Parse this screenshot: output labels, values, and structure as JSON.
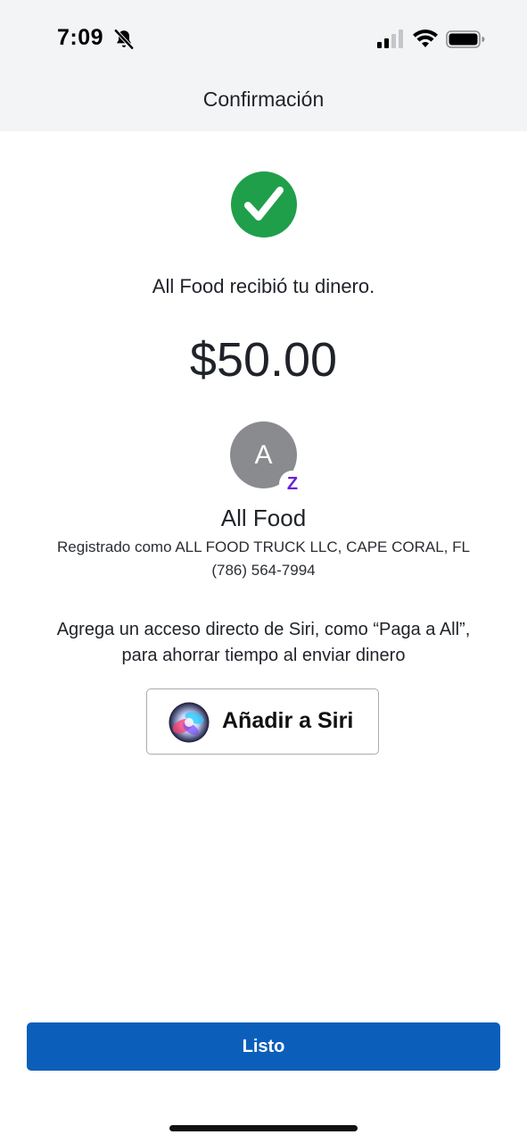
{
  "status_bar": {
    "time": "7:09",
    "icons": [
      "bell-slash-icon",
      "cellular-signal-icon",
      "wifi-icon",
      "battery-icon"
    ]
  },
  "header": {
    "title": "Confirmación"
  },
  "confirmation": {
    "status_icon": "checkmark-circle-icon",
    "message": "All Food recibió tu dinero.",
    "amount": "$50.00"
  },
  "recipient": {
    "avatar_initial": "A",
    "badge_icon": "zelle-z-icon",
    "badge_text": "Z",
    "name": "All Food",
    "registered_as": "Registrado como ALL FOOD TRUCK LLC, CAPE CORAL, FL",
    "phone": "(786) 564-7994"
  },
  "siri": {
    "hint_line1": "Agrega un acceso directo de Siri, como “Paga a All”,",
    "hint_line2": "para ahorrar tiempo al enviar dinero",
    "button_label": "Añadir a Siri",
    "icon": "siri-icon"
  },
  "footer": {
    "done_label": "Listo"
  },
  "colors": {
    "header_bg": "#f3f4f6",
    "success_green": "#1f9f4a",
    "primary_blue": "#0b5fbb",
    "zelle_purple": "#6d1ed4",
    "avatar_gray": "#898b8e"
  }
}
